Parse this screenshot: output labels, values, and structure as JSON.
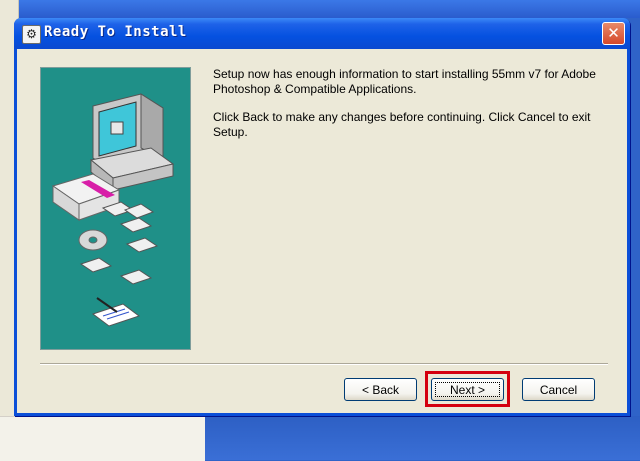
{
  "window": {
    "title": "Ready To Install",
    "title_icon": "installer-icon",
    "close_label": "✕"
  },
  "message": {
    "paragraph1": "Setup now has enough information to start installing 55mm v7 for Adobe Photoshop & Compatible Applications.",
    "paragraph2": "Click Back to make any changes before continuing. Click Cancel to exit Setup."
  },
  "buttons": {
    "back": "< Back",
    "next": "Next >",
    "cancel": "Cancel"
  },
  "colors": {
    "titlebar": "#0551e0",
    "art_bg": "#1f9088",
    "highlight": "#d4000f"
  }
}
